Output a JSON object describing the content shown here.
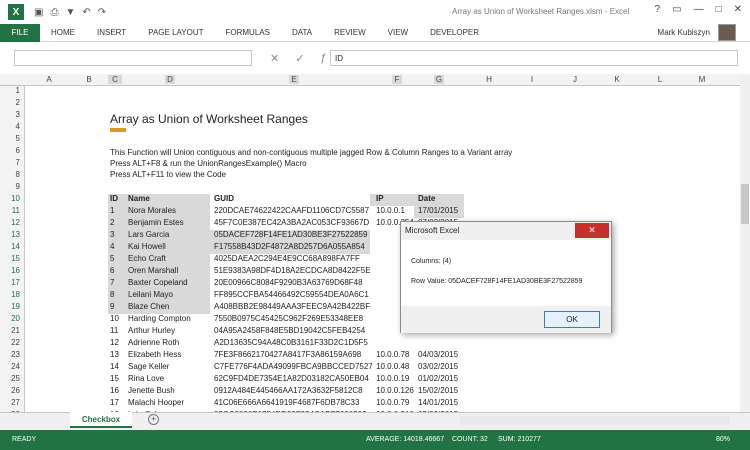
{
  "window": {
    "title": "Array as Union of Worksheet Ranges.xlsm - Excel",
    "user": "Mark Kubiszyn",
    "controls": [
      "?",
      "▭",
      "—",
      "□",
      "✕"
    ]
  },
  "ribbon": {
    "file": "FILE",
    "tabs": [
      "HOME",
      "INSERT",
      "PAGE LAYOUT",
      "FORMULAS",
      "DATA",
      "REVIEW",
      "VIEW",
      "DEVELOPER"
    ]
  },
  "formula": {
    "value": "ID"
  },
  "columns": [
    "A",
    "B",
    "C",
    "D",
    "E",
    "F",
    "G",
    "H",
    "I",
    "J",
    "K",
    "L",
    "M"
  ],
  "rows": [
    "1",
    "2",
    "3",
    "4",
    "5",
    "6",
    "7",
    "8",
    "9",
    "10",
    "11",
    "12",
    "13",
    "14",
    "15",
    "16",
    "17",
    "18",
    "19",
    "20",
    "21",
    "22",
    "23",
    "24",
    "25",
    "26",
    "27",
    "28"
  ],
  "sheet": {
    "title": "Array as Union of Worksheet Ranges",
    "desc": [
      "This Function will Union contiguous and non-contiguous multiple jagged Row & Column Ranges to a Variant array",
      "Press ALT+F8 & run the UnionRangesExample() Macro",
      "Press ALT+F11 to view the Code"
    ],
    "headers": {
      "id": "ID",
      "name": "Name",
      "guid": "GUID",
      "ip": "IP",
      "date": "Date"
    },
    "table": [
      [
        "1",
        "Nora Morales",
        "220DCAE74622422CAAFD1106CD7C5587",
        "10.0.0.1",
        "17/01/2015"
      ],
      [
        "2",
        "Benjamin Estes",
        "45F7C0E387EC42A3BA2AC053CF93667D",
        "10.0.0.254",
        "07/03/2015"
      ],
      [
        "3",
        "Lars Garcia",
        "05DACEF728F14FE1AD30BE3F27522859",
        "",
        ""
      ],
      [
        "4",
        "Kai Howell",
        "F17558B43D2F4872A8D257D6A055A854",
        "",
        ""
      ],
      [
        "5",
        "Echo Craft",
        "4025DAEA2C294E4E9CC68A898FA7FF",
        "",
        ""
      ],
      [
        "6",
        "Oren Marshall",
        "51E9383A98DF4D18A2ECDCA8D8422F5E",
        "",
        ""
      ],
      [
        "7",
        "Baxter Copeland",
        "20E00966C8084F9290B3A63769D68F48",
        "",
        ""
      ],
      [
        "8",
        "Leilani Mayo",
        "FF895CCFBA54466492C59554DEA0A6C1",
        "",
        ""
      ],
      [
        "9",
        "Blaze Chen",
        "A408BBB2E98449AAA3FEEC9A42B422BF",
        "",
        ""
      ],
      [
        "10",
        "Harding Compton",
        "7550B0975C45425C962F269E53348EE8",
        "",
        ""
      ],
      [
        "11",
        "Arthur Hurley",
        "04A95A2458F848E5BD19042C5FEB4254",
        "",
        ""
      ],
      [
        "12",
        "Adrienne Roth",
        "A2D13635C94A48C0B3161F33D2C1D5F5",
        "",
        ""
      ],
      [
        "13",
        "Elizabeth Hess",
        "7FE3F8662170427A8417F3A86159A698",
        "10.0.0.78",
        "04/03/2015"
      ],
      [
        "14",
        "Sage Keller",
        "C7FE776F4ADA49099FBCA9BBCCED7527",
        "10.0.0.48",
        "03/02/2015"
      ],
      [
        "15",
        "Rina Love",
        "62C9FD4DE7354E1A82D03182CA50EB04",
        "10.0.0.19",
        "01/02/2015"
      ],
      [
        "16",
        "Jenette Bush",
        "0912A484E445466AA172A3632F5812C8",
        "10.0.0.126",
        "15/02/2015"
      ],
      [
        "17",
        "Malachi Hooper",
        "41C06E666A6641919F4687F6DB78C33",
        "10.0.0.79",
        "14/01/2015"
      ],
      [
        "18",
        "Lyle Osborne",
        "85CC9836E1754DD99F394CABF7690393",
        "10.0.0.210",
        "05/02/2015"
      ]
    ]
  },
  "dialog": {
    "title": "Microsoft Excel",
    "close": "✕",
    "line1": "Columns: (4)",
    "line2": "Row Value: 05DACEF728F14FE1AD30BE3F27522859",
    "ok": "OK"
  },
  "tabs": {
    "sheet": "Checkbox",
    "add": "+"
  },
  "status": {
    "ready": "READY",
    "average": "AVERAGE: 14018.46667",
    "count": "COUNT: 32",
    "sum": "SUM: 210277",
    "zoom": "80%"
  },
  "colors": {
    "excel_green": "#217346",
    "selection": "#d9d9d9",
    "accent": "#d99a1e"
  }
}
